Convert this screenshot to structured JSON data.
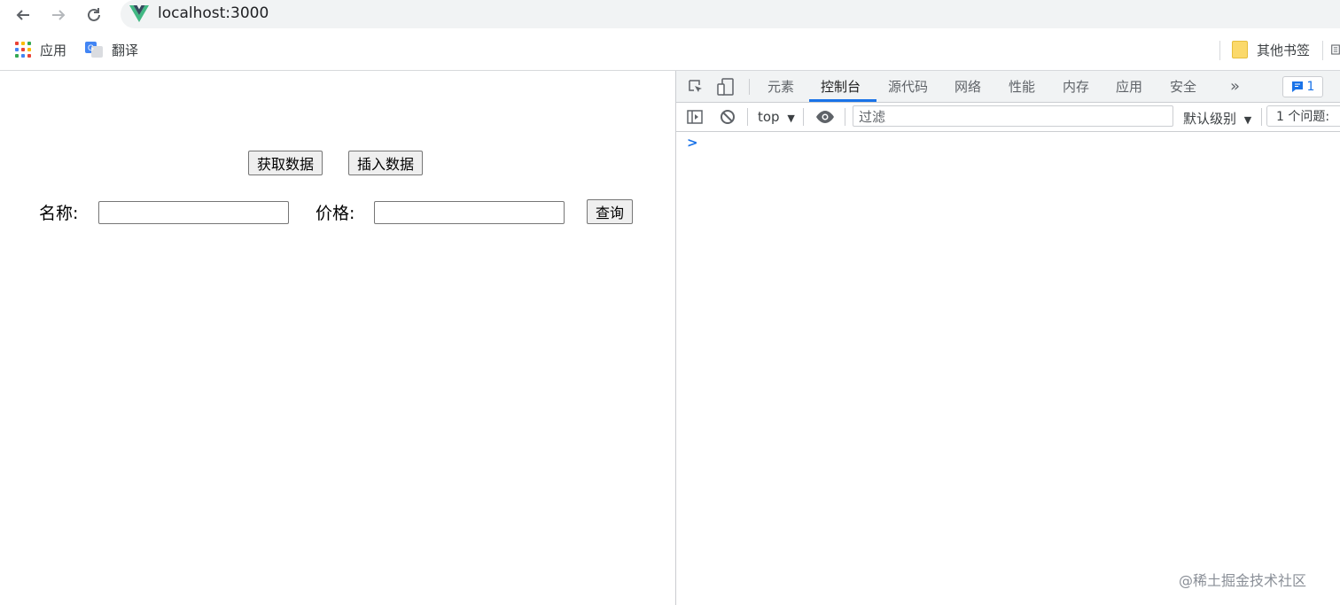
{
  "browser": {
    "url": "localhost:3000",
    "back_icon": "arrow-left-icon",
    "forward_icon": "arrow-right-icon",
    "reload_icon": "reload-icon"
  },
  "bookmarks": {
    "apps_label": "应用",
    "translate_label": "翻译",
    "other_label": "其他书签"
  },
  "page": {
    "get_data_button": "获取数据",
    "insert_data_button": "插入数据",
    "name_label": "名称:",
    "price_label": "价格:",
    "name_value": "",
    "price_value": "",
    "query_button": "查询"
  },
  "devtools": {
    "tabs": [
      {
        "label": "元素"
      },
      {
        "label": "控制台"
      },
      {
        "label": "源代码"
      },
      {
        "label": "网络"
      },
      {
        "label": "性能"
      },
      {
        "label": "内存"
      },
      {
        "label": "应用"
      },
      {
        "label": "安全"
      }
    ],
    "more_tabs": "»",
    "active_tab": "控制台",
    "message_count": "1",
    "context": "top",
    "filter_placeholder": "过滤",
    "level": "默认级别",
    "issues": "1 个问题:",
    "prompt": ">",
    "accent": "#1a73e8"
  },
  "watermark": "@稀土掘金技术社区"
}
